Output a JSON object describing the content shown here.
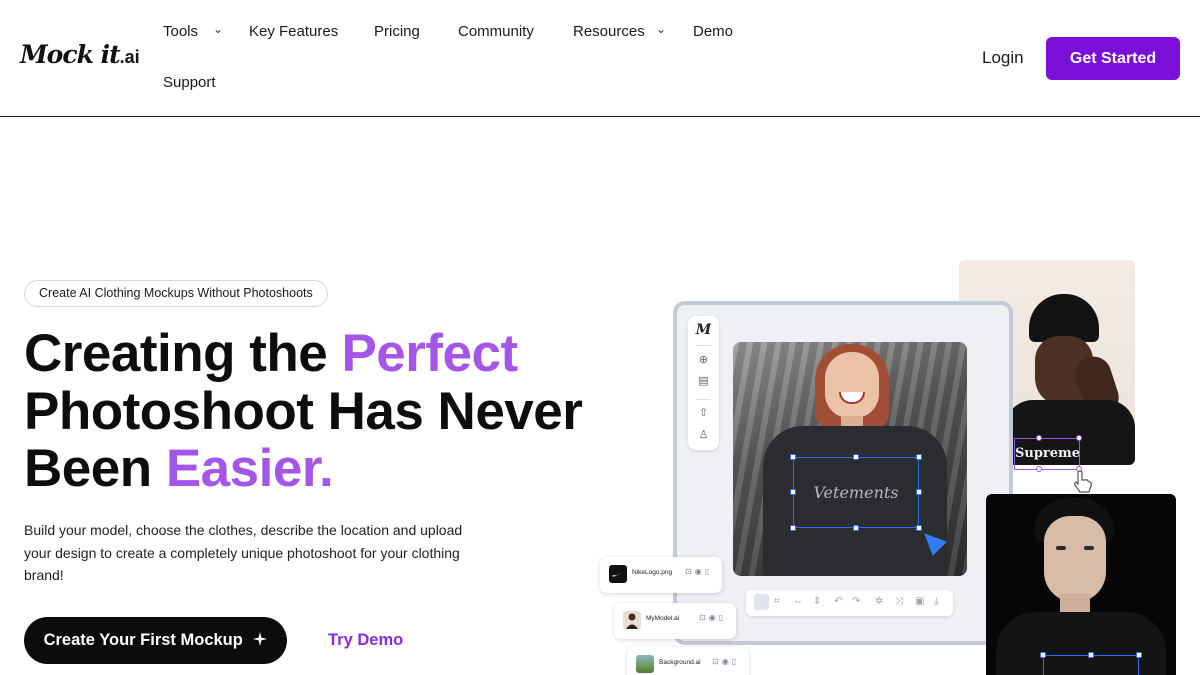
{
  "brand": {
    "logo_main": "Mock it",
    "logo_suffix": ".ai"
  },
  "nav": {
    "items": [
      {
        "label": "Tools",
        "has_dropdown": true
      },
      {
        "label": "Key Features",
        "has_dropdown": false
      },
      {
        "label": "Pricing",
        "has_dropdown": false
      },
      {
        "label": "Community",
        "has_dropdown": false
      },
      {
        "label": "Resources",
        "has_dropdown": true
      },
      {
        "label": "Demo",
        "has_dropdown": false
      },
      {
        "label": "Support",
        "has_dropdown": false
      }
    ],
    "dropdown_glyph": "⌄",
    "login_label": "Login",
    "get_started_label": "Get Started"
  },
  "hero": {
    "pill_text": "Create AI Clothing Mockups Without Photoshoots",
    "headline": {
      "line1_prefix": "Creating the ",
      "line1_accent": "Perfect",
      "line2": "Photoshoot Has Never",
      "line3_prefix": "Been ",
      "line3_accent": "Easier."
    },
    "subtext": "Build your model, choose the clothes, describe the location and upload your design to create a completely unique photoshoot for your clothing brand!",
    "cta_primary_label": "Create Your First Mockup",
    "cta_primary_icon": "sparkle-icon",
    "cta_secondary_label": "Try Demo"
  },
  "editor": {
    "toolbar_logo": "M",
    "shirt_print_main": "Vetements",
    "shirt_print_top": "Supreme",
    "layers": [
      {
        "name": "NikeLogo.png",
        "thumb_icon": "swoosh-icon"
      },
      {
        "name": "MyModel.ai",
        "thumb_icon": "model-icon"
      },
      {
        "name": "Background.ai",
        "thumb_icon": "landscape-icon"
      }
    ]
  },
  "colors": {
    "brand_purple": "#7a0fd9",
    "accent_lilac": "#a456e8",
    "link_purple": "#8a2be2",
    "selection_blue": "#2f6ff0",
    "selection_purple": "#8b5cf6",
    "cta_black": "#0c0c0c"
  }
}
